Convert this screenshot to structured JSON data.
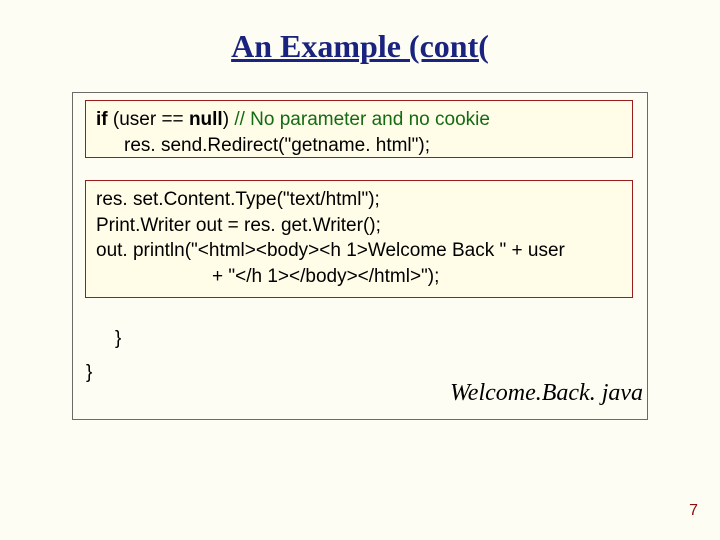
{
  "title": "An Example (cont(",
  "code_block1": {
    "l1_kw1": "if",
    "l1_mid": " (user == ",
    "l1_kw2": "null",
    "l1_rest": ")   ",
    "l1_comment": "// No parameter and no cookie",
    "l2": "res. send.Redirect(\"getname. html\");"
  },
  "code_block2": {
    "l1": "res. set.Content.Type(\"text/html\");",
    "l2": "Print.Writer out = res. get.Writer();",
    "l3": "out. println(\"<html><body><h 1>Welcome Back \" + user",
    "l4": "+ \"</h 1></body></html>\");"
  },
  "brace1": "}",
  "brace2": "}",
  "caption": "Welcome.Back. java",
  "page_number": "7"
}
